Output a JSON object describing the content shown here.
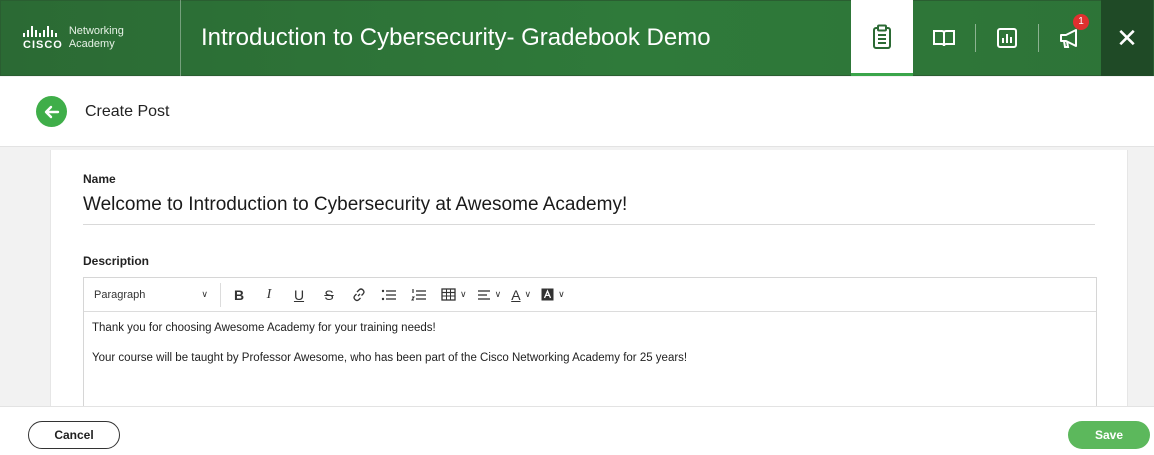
{
  "header": {
    "logo_cisco": "CISCO",
    "logo_line1": "Networking",
    "logo_line2": "Academy",
    "title": "Introduction to Cybersecurity- Gradebook Demo",
    "notification_count": "1",
    "icons": [
      "clipboard-icon",
      "book-icon",
      "chart-icon",
      "megaphone-icon",
      "close-icon"
    ]
  },
  "subheader": {
    "title": "Create Post"
  },
  "form": {
    "name_label": "Name",
    "name_value": "Welcome to Introduction to Cybersecurity at Awesome Academy!",
    "description_label": "Description",
    "editor": {
      "paragraph_style": "Paragraph",
      "toolbar_icons": [
        "bold",
        "italic",
        "underline",
        "strikethrough",
        "link",
        "bullet-list",
        "numbered-list",
        "table",
        "align",
        "text-color",
        "highlight-color"
      ],
      "bold_glyph": "B",
      "italic_glyph": "I",
      "underline_glyph": "U",
      "strike_glyph": "S",
      "text_color_glyph": "A",
      "lines": [
        "Thank you for choosing Awesome Academy for your training needs!",
        "Your course will be taught by Professor Awesome, who has been part of the Cisco Networking Academy for 25 years!"
      ]
    }
  },
  "footer": {
    "cancel_label": "Cancel",
    "save_label": "Save"
  },
  "colors": {
    "header_green": "#2b6a34",
    "accent_green": "#3fae49",
    "save_green": "#5cb85c",
    "badge_red": "#e0302f"
  }
}
